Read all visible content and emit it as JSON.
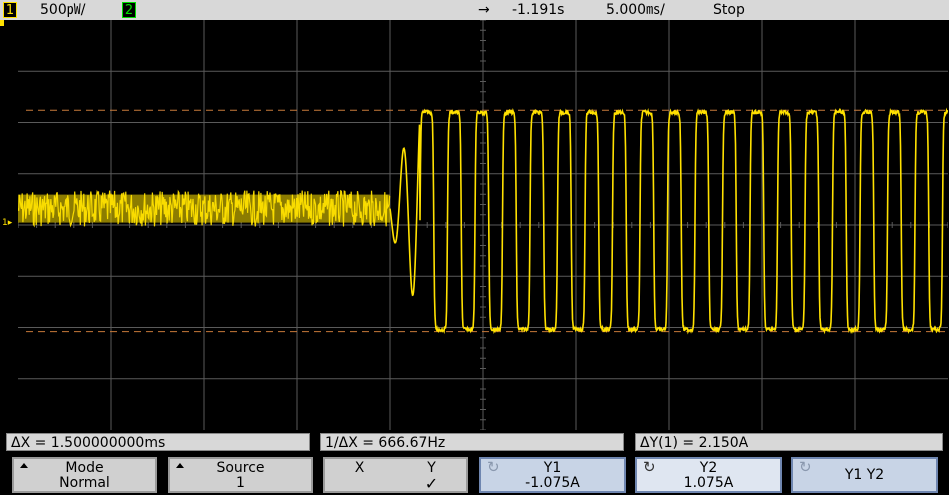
{
  "status_bar": {
    "ch1_num": "1",
    "ch1_scale": "500㎺/",
    "ch2_num": "2",
    "arrow": "→",
    "delay": "-1.191s",
    "timebase": "5.000㎳/",
    "run_state": "Stop"
  },
  "display": {
    "ground_marker": "1▸",
    "trace_color": "#ffe100",
    "cursor_color": "#c87a3a",
    "grid_color": "#5a5a5a"
  },
  "measurements": {
    "delta_x": "ΔX = 1.500000000ms",
    "inverse_delta_x": "1/ΔX = 666.67Hz",
    "delta_y": "ΔY(1) = 2.150A"
  },
  "softkeys": [
    {
      "line1": "Mode",
      "line2": "Normal",
      "icon": "up-triangle-icon"
    },
    {
      "line1": "Source",
      "line2": "1",
      "icon": "up-triangle-icon"
    },
    {
      "line1": "X",
      "line1b": "Y",
      "line2": "✓",
      "icon": ""
    },
    {
      "line1": "Y1",
      "line2": "-1.075A",
      "icon": "cycle-icon"
    },
    {
      "line1": "Y2",
      "line2": "1.075A",
      "icon": "cycle-icon"
    },
    {
      "line1": "Y1 Y2",
      "line2": "",
      "icon": "cycle-icon"
    }
  ],
  "waveform": {
    "noise_level_fraction": 0.46,
    "cursor_y1_fraction": 0.76,
    "cursor_y2_fraction": 0.22
  }
}
